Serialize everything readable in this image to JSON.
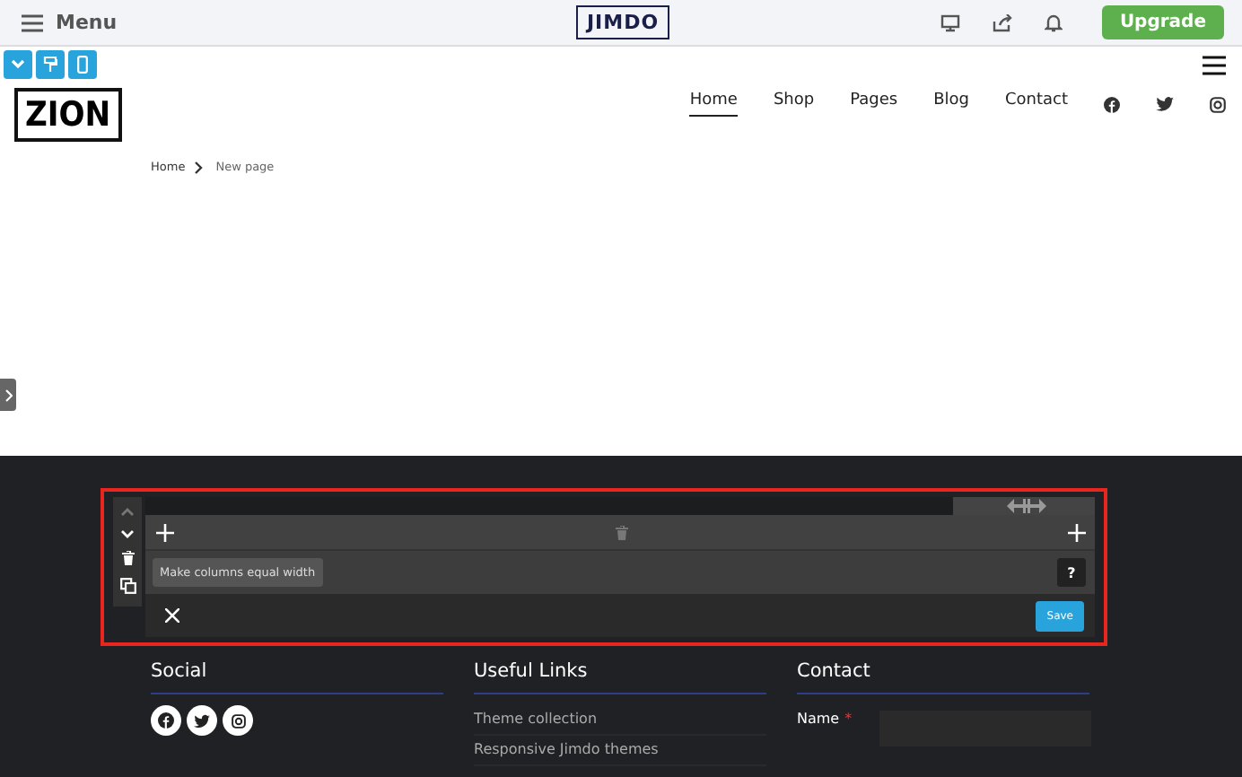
{
  "topbar": {
    "menu_label": "Menu",
    "logo": "JIMDO",
    "upgrade": "Upgrade"
  },
  "site": {
    "logo": "ZION",
    "nav": [
      {
        "label": "Home",
        "selected": true
      },
      {
        "label": "Shop",
        "selected": false
      },
      {
        "label": "Pages",
        "selected": false
      },
      {
        "label": "Blog",
        "selected": false
      },
      {
        "label": "Contact",
        "selected": false
      }
    ]
  },
  "breadcrumb": [
    "Home",
    "New page"
  ],
  "editor": {
    "tooltip": "Make columns equal width",
    "help": "?",
    "save": "Save"
  },
  "footer": {
    "social_title": "Social",
    "links_title": "Useful Links",
    "links": [
      "Theme collection",
      "Responsive Jimdo themes"
    ],
    "contact_title": "Contact",
    "name_label": "Name",
    "required_mark": "*"
  }
}
